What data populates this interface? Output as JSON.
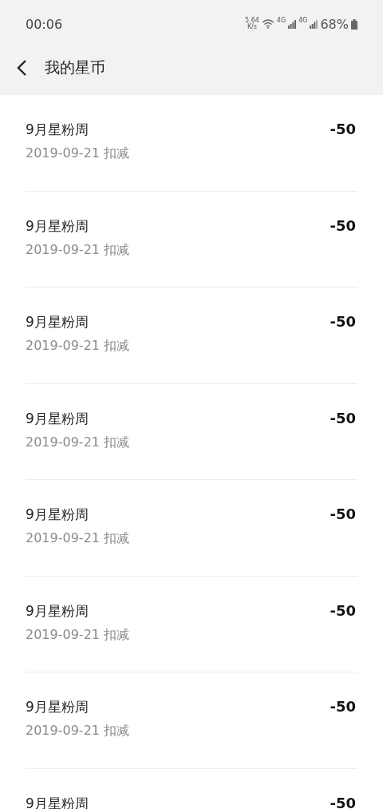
{
  "status_bar": {
    "time": "00:06",
    "net_speed": "5.64",
    "net_unit": "K/s",
    "sim_1": "4G",
    "sim_2": "4G",
    "battery": "68%"
  },
  "header": {
    "title": "我的星币"
  },
  "records": [
    {
      "title": "9月星粉周",
      "date": "2019-09-21 扣减",
      "amount": "-50"
    },
    {
      "title": "9月星粉周",
      "date": "2019-09-21 扣减",
      "amount": "-50"
    },
    {
      "title": "9月星粉周",
      "date": "2019-09-21 扣减",
      "amount": "-50"
    },
    {
      "title": "9月星粉周",
      "date": "2019-09-21 扣减",
      "amount": "-50"
    },
    {
      "title": "9月星粉周",
      "date": "2019-09-21 扣减",
      "amount": "-50"
    },
    {
      "title": "9月星粉周",
      "date": "2019-09-21 扣减",
      "amount": "-50"
    },
    {
      "title": "9月星粉周",
      "date": "2019-09-21 扣减",
      "amount": "-50"
    },
    {
      "title": "9月星粉周",
      "amount": "-50"
    }
  ]
}
